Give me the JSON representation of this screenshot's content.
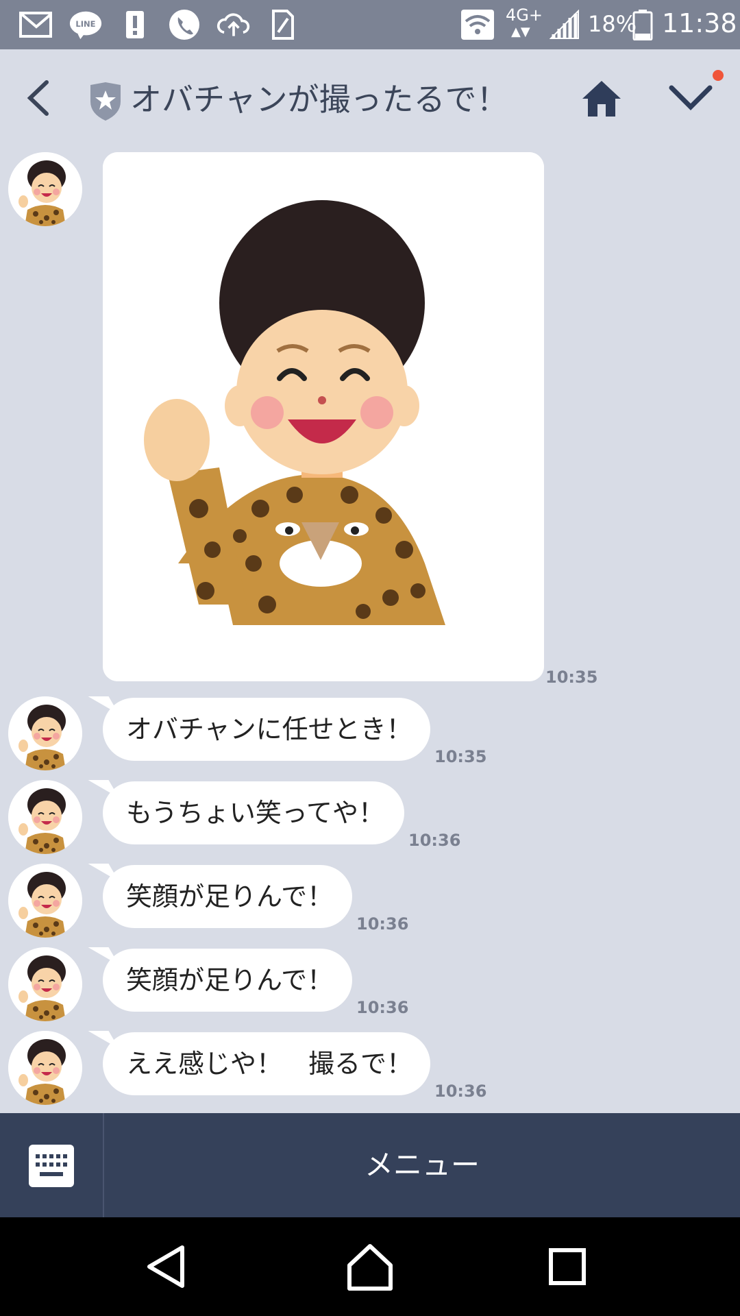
{
  "status_bar": {
    "network": "4G+",
    "battery": "18%",
    "time": "11:38",
    "icons": [
      "gmail-icon",
      "line-icon",
      "alert-icon",
      "phone-icon",
      "cloud-upload-icon",
      "sim-icon",
      "wifi-icon",
      "signal-icon",
      "battery-icon"
    ]
  },
  "header": {
    "title": "オバチャンが撮ったるで！",
    "has_notification_dot": true
  },
  "messages": [
    {
      "type": "image",
      "time": "10:35"
    },
    {
      "type": "text",
      "text": "オバチャンに任せとき！",
      "time": "10:35"
    },
    {
      "type": "text",
      "text": "もうちょい笑ってや！",
      "time": "10:36"
    },
    {
      "type": "text",
      "text": "笑顔が足りんで！",
      "time": "10:36"
    },
    {
      "type": "text",
      "text": "笑顔が足りんで！",
      "time": "10:36"
    },
    {
      "type": "text",
      "text": "ええ感じや！　撮るで！",
      "time": "10:36"
    }
  ],
  "menu_bar": {
    "label": "メニュー"
  },
  "colors": {
    "background": "#d8dce6",
    "menu_bar": "#35415a",
    "notification_dot": "#f0553a"
  }
}
